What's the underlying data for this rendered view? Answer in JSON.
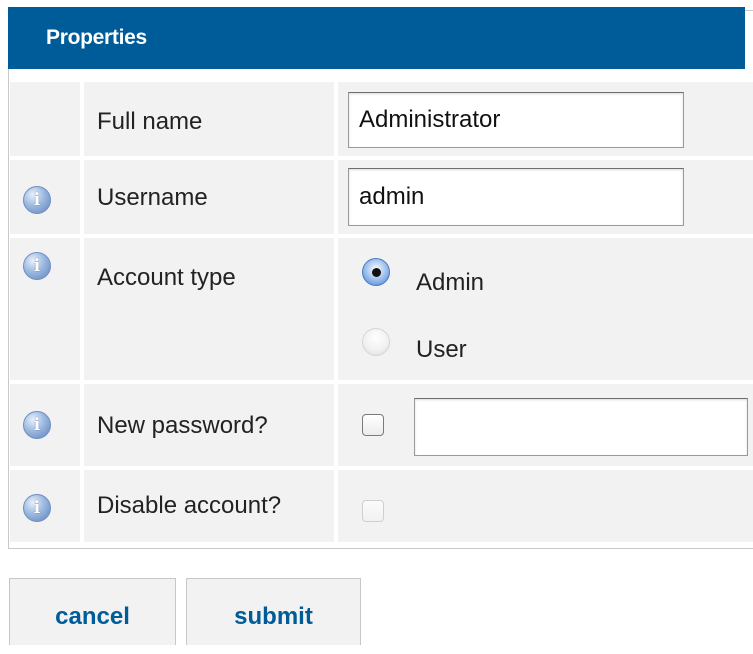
{
  "panel": {
    "title": "Properties"
  },
  "fields": {
    "full_name": {
      "label": "Full name",
      "value": "Administrator"
    },
    "username": {
      "label": "Username",
      "value": "admin",
      "info_icon": "info-icon"
    },
    "account_type": {
      "label": "Account type",
      "info_icon": "info-icon",
      "options": [
        {
          "label": "Admin",
          "selected": true
        },
        {
          "label": "User",
          "selected": false
        }
      ]
    },
    "new_password": {
      "label": "New password?",
      "info_icon": "info-icon",
      "checked": false,
      "value": ""
    },
    "disable_account": {
      "label": "Disable account?",
      "info_icon": "info-icon",
      "checked": false,
      "disabled": true
    }
  },
  "buttons": {
    "cancel": "cancel",
    "submit": "submit"
  },
  "colors": {
    "header": "#005c99",
    "cell_bg": "#f2f2f2",
    "button_text": "#005c99"
  }
}
